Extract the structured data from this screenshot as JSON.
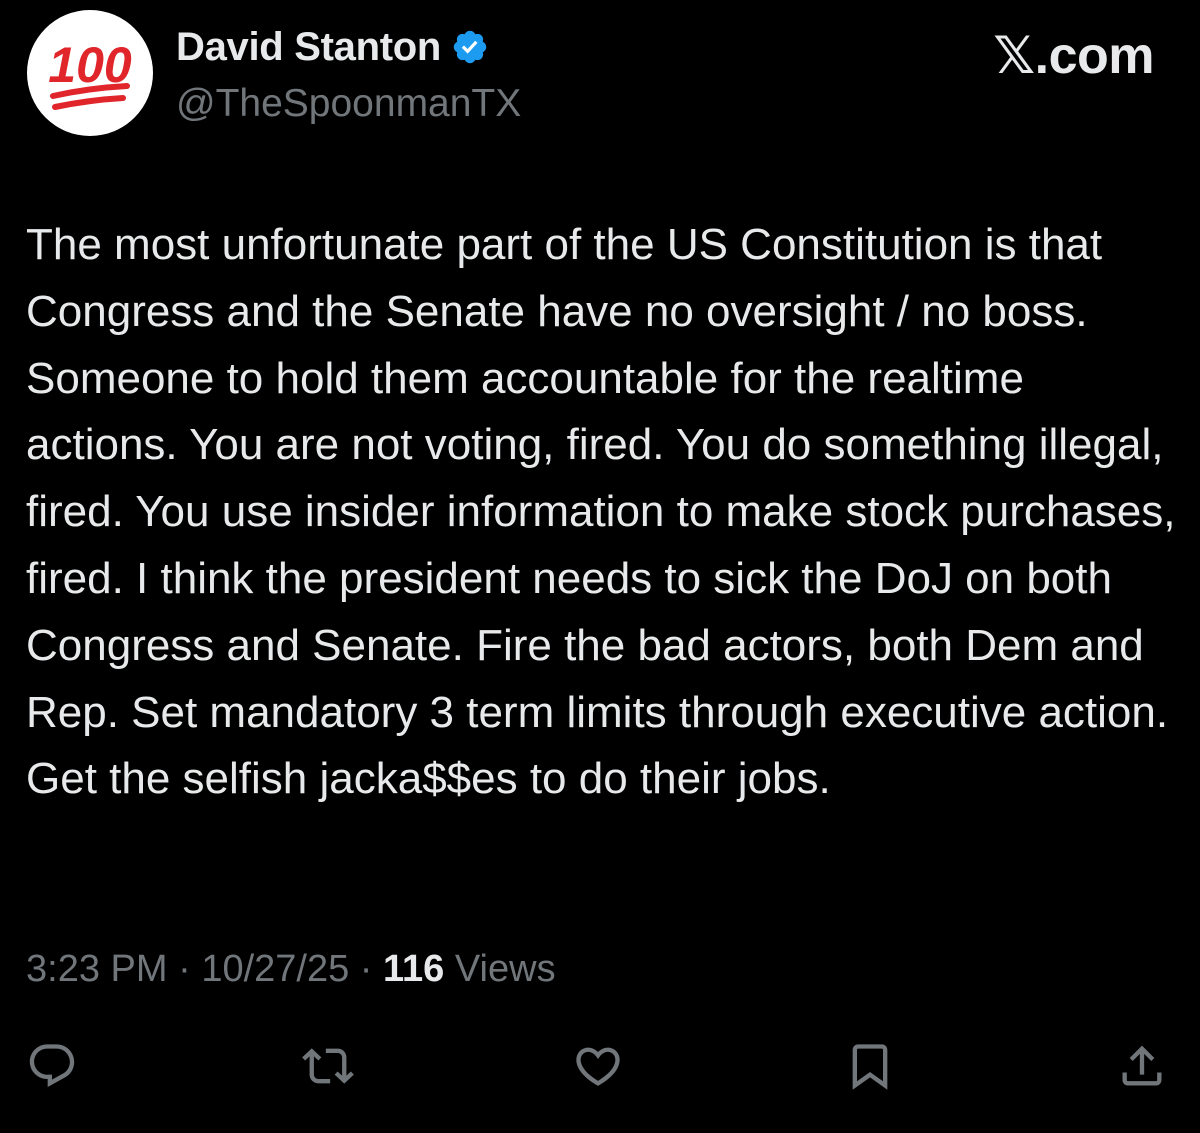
{
  "author": {
    "display_name": "David Stanton",
    "handle": "@TheSpoonmanTX",
    "avatar_text": "100",
    "verified": true,
    "verified_color": "#1d9bf0"
  },
  "brand": {
    "label": ".com",
    "logo_glyph": "𝕏"
  },
  "tweet": {
    "text": "The most unfortunate part of the US Constitution is that Congress and the Senate have no oversight / no boss.  Someone to hold them accountable for the realtime actions.  You are not voting, fired.  You do something illegal, fired.  You use insider information to make stock purchases, fired.  I think the president needs to sick the DoJ on both Congress and Senate.  Fire the bad actors, both Dem and Rep.  Set mandatory 3 term limits through executive action.  Get the selfish jacka$$es to do their jobs."
  },
  "meta": {
    "time": "3:23 PM",
    "separator": " · ",
    "date": "10/27/25",
    "views_count": "116",
    "views_label": " Views"
  },
  "actions": [
    {
      "name": "reply",
      "icon": "reply-icon"
    },
    {
      "name": "retweet",
      "icon": "retweet-icon"
    },
    {
      "name": "like",
      "icon": "heart-icon"
    },
    {
      "name": "bookmark",
      "icon": "bookmark-icon"
    },
    {
      "name": "share",
      "icon": "share-icon"
    }
  ],
  "colors": {
    "background": "#000000",
    "text": "#e7e9ea",
    "muted": "#71767b",
    "emoji_red": "#e0252b"
  }
}
